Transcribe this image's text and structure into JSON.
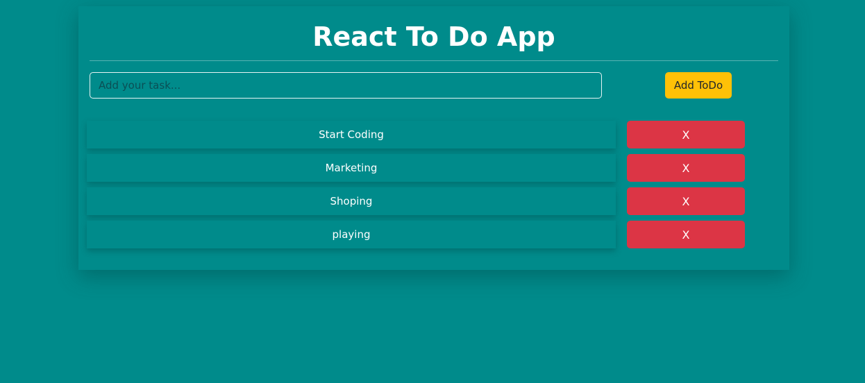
{
  "header": {
    "title": "React To Do App"
  },
  "form": {
    "input_placeholder": "Add your task...",
    "input_value": "",
    "add_button_label": "Add ToDo"
  },
  "todos": [
    {
      "text": "Start Coding",
      "delete_label": "X"
    },
    {
      "text": "Marketing",
      "delete_label": "X"
    },
    {
      "text": "Shoping",
      "delete_label": "X"
    },
    {
      "text": "playing",
      "delete_label": "X"
    }
  ],
  "colors": {
    "background": "#008b8b",
    "add_button": "#ffc107",
    "delete_button": "#dc3545",
    "text": "#ffffff"
  }
}
